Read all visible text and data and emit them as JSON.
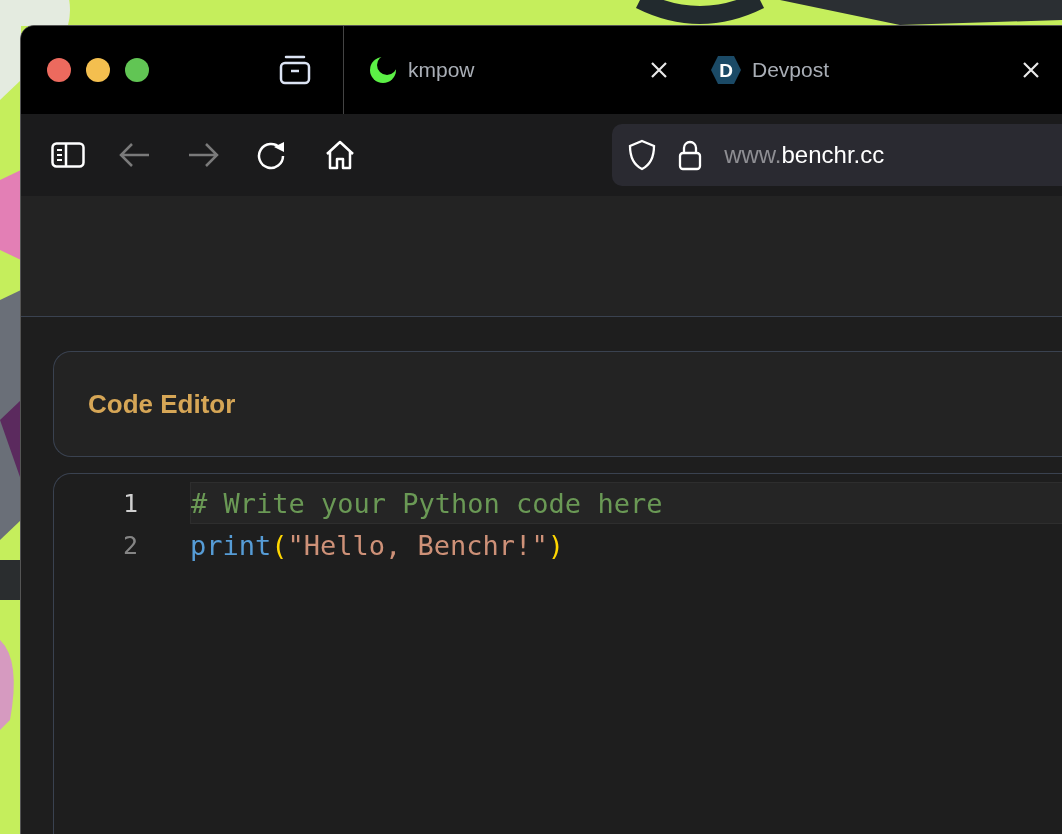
{
  "window_controls": [
    {
      "color": "#ec6a5e"
    },
    {
      "color": "#f4bf4f"
    },
    {
      "color": "#61c554"
    }
  ],
  "tabs": [
    {
      "title": "kmpow",
      "kind": "moon"
    },
    {
      "title": "Devpost",
      "kind": "hexagon",
      "favicon_letter": "D"
    }
  ],
  "url": {
    "prefix": "www.",
    "domain": "benchr.cc"
  },
  "editor_card": {
    "title": "Code Editor"
  },
  "code_lines": [
    {
      "number": "1",
      "active": true,
      "tokens": [
        {
          "kind": "comment",
          "text": "# Write your Python code here"
        }
      ]
    },
    {
      "number": "2",
      "active": false,
      "tokens": [
        {
          "kind": "function",
          "text": "print"
        },
        {
          "kind": "bracket",
          "text": "("
        },
        {
          "kind": "string",
          "text": "\"Hello, Benchr!\""
        },
        {
          "kind": "bracket",
          "text": ")"
        }
      ]
    }
  ]
}
